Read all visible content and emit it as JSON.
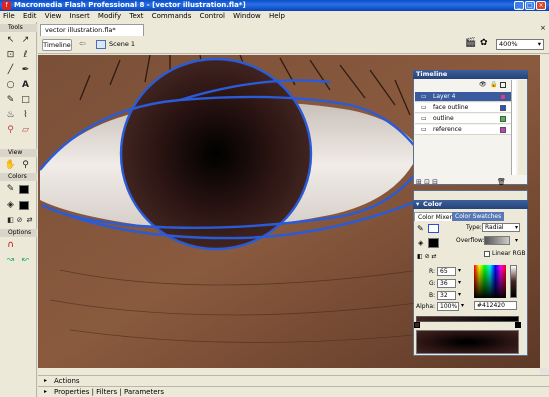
{
  "app": {
    "title": "Macromedia Flash Professional 8 - [vector illustration.fla*]"
  },
  "menu": [
    "File",
    "Edit",
    "View",
    "Insert",
    "Modify",
    "Text",
    "Commands",
    "Control",
    "Window",
    "Help"
  ],
  "tools": {
    "header": "Tools",
    "view_label": "View",
    "colors_label": "Colors",
    "options_label": "Options"
  },
  "document": {
    "tab": "vector illustration.fla*",
    "timeline_button": "Timeline",
    "scene": "Scene 1",
    "zoom": "400%"
  },
  "timeline_panel": {
    "title": "Timeline",
    "layers": [
      {
        "name": "Layer 4",
        "color": "#c040c0"
      },
      {
        "name": "face outline",
        "color": "#2a4fd8"
      },
      {
        "name": "outline",
        "color": "#40c040"
      },
      {
        "name": "reference",
        "color": "#c040c0"
      }
    ]
  },
  "color_panel": {
    "title": "Color",
    "tabs": [
      "Color Mixer",
      "Color Swatches"
    ],
    "type_label": "Type:",
    "type_value": "Radial",
    "overflow_label": "Overflow:",
    "linear_rgb_label": "Linear RGB",
    "r_label": "R:",
    "r_value": "65",
    "g_label": "G:",
    "g_value": "36",
    "b_label": "B:",
    "b_value": "32",
    "alpha_label": "Alpha:",
    "alpha_value": "100%",
    "hex_value": "#412420",
    "gradient_start": "#412420",
    "gradient_end": "#000000"
  },
  "bottom_panels": {
    "actions": "Actions",
    "properties_tabs": "Properties | Filters | Parameters"
  }
}
